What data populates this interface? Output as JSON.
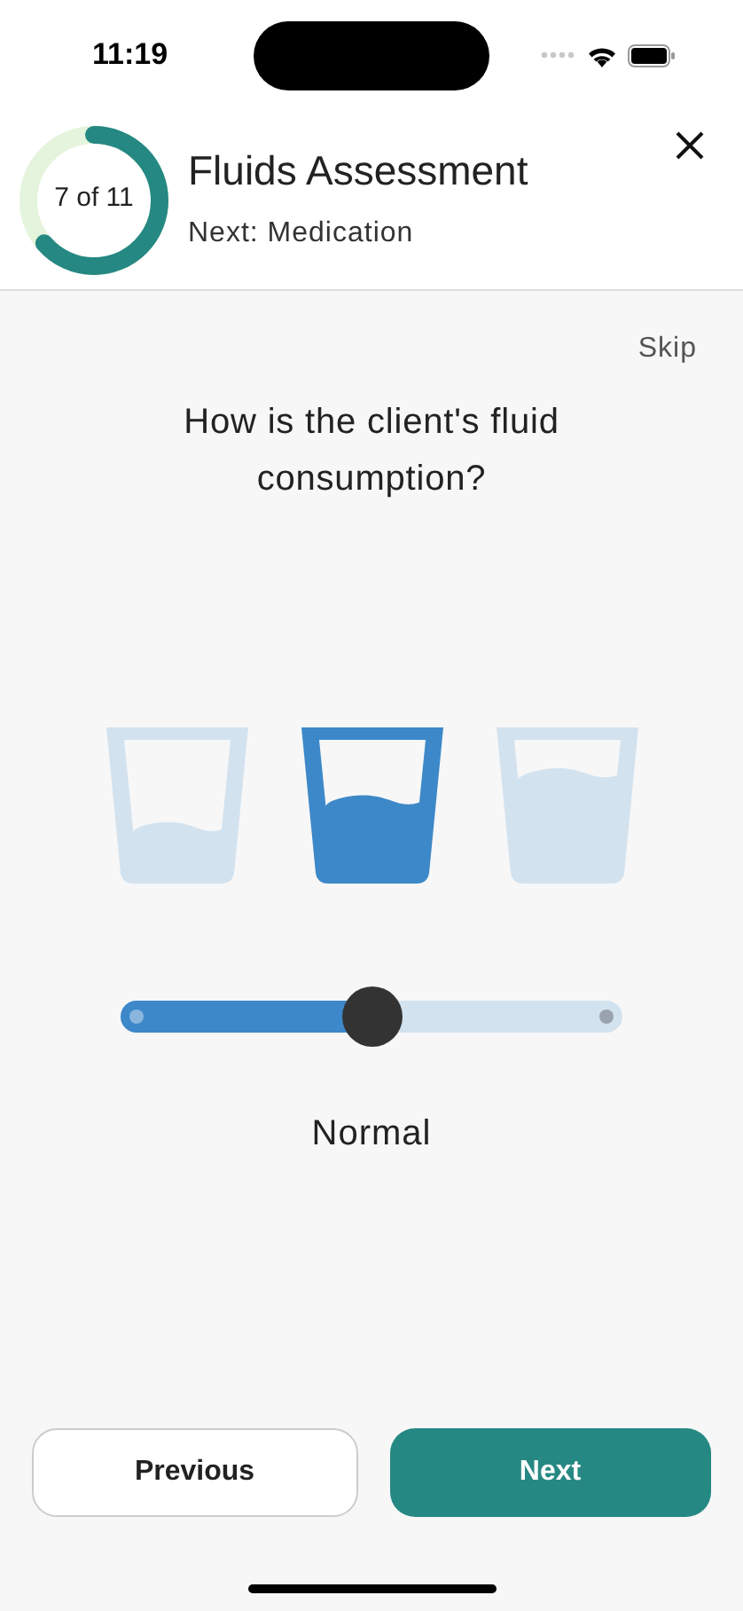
{
  "status_bar": {
    "time": "11:19"
  },
  "header": {
    "progress": {
      "label": "7 of 11"
    },
    "title": "Fluids Assessment",
    "subtitle": "Next: Medication"
  },
  "skip": "Skip",
  "question": "How is the client's fluid consumption?",
  "glasses": [
    {
      "selected": false
    },
    {
      "selected": true
    },
    {
      "selected": false
    }
  ],
  "slider": {
    "level": 0.5
  },
  "answer": "Normal",
  "buttons": {
    "previous": "Previous",
    "next": "Next"
  }
}
